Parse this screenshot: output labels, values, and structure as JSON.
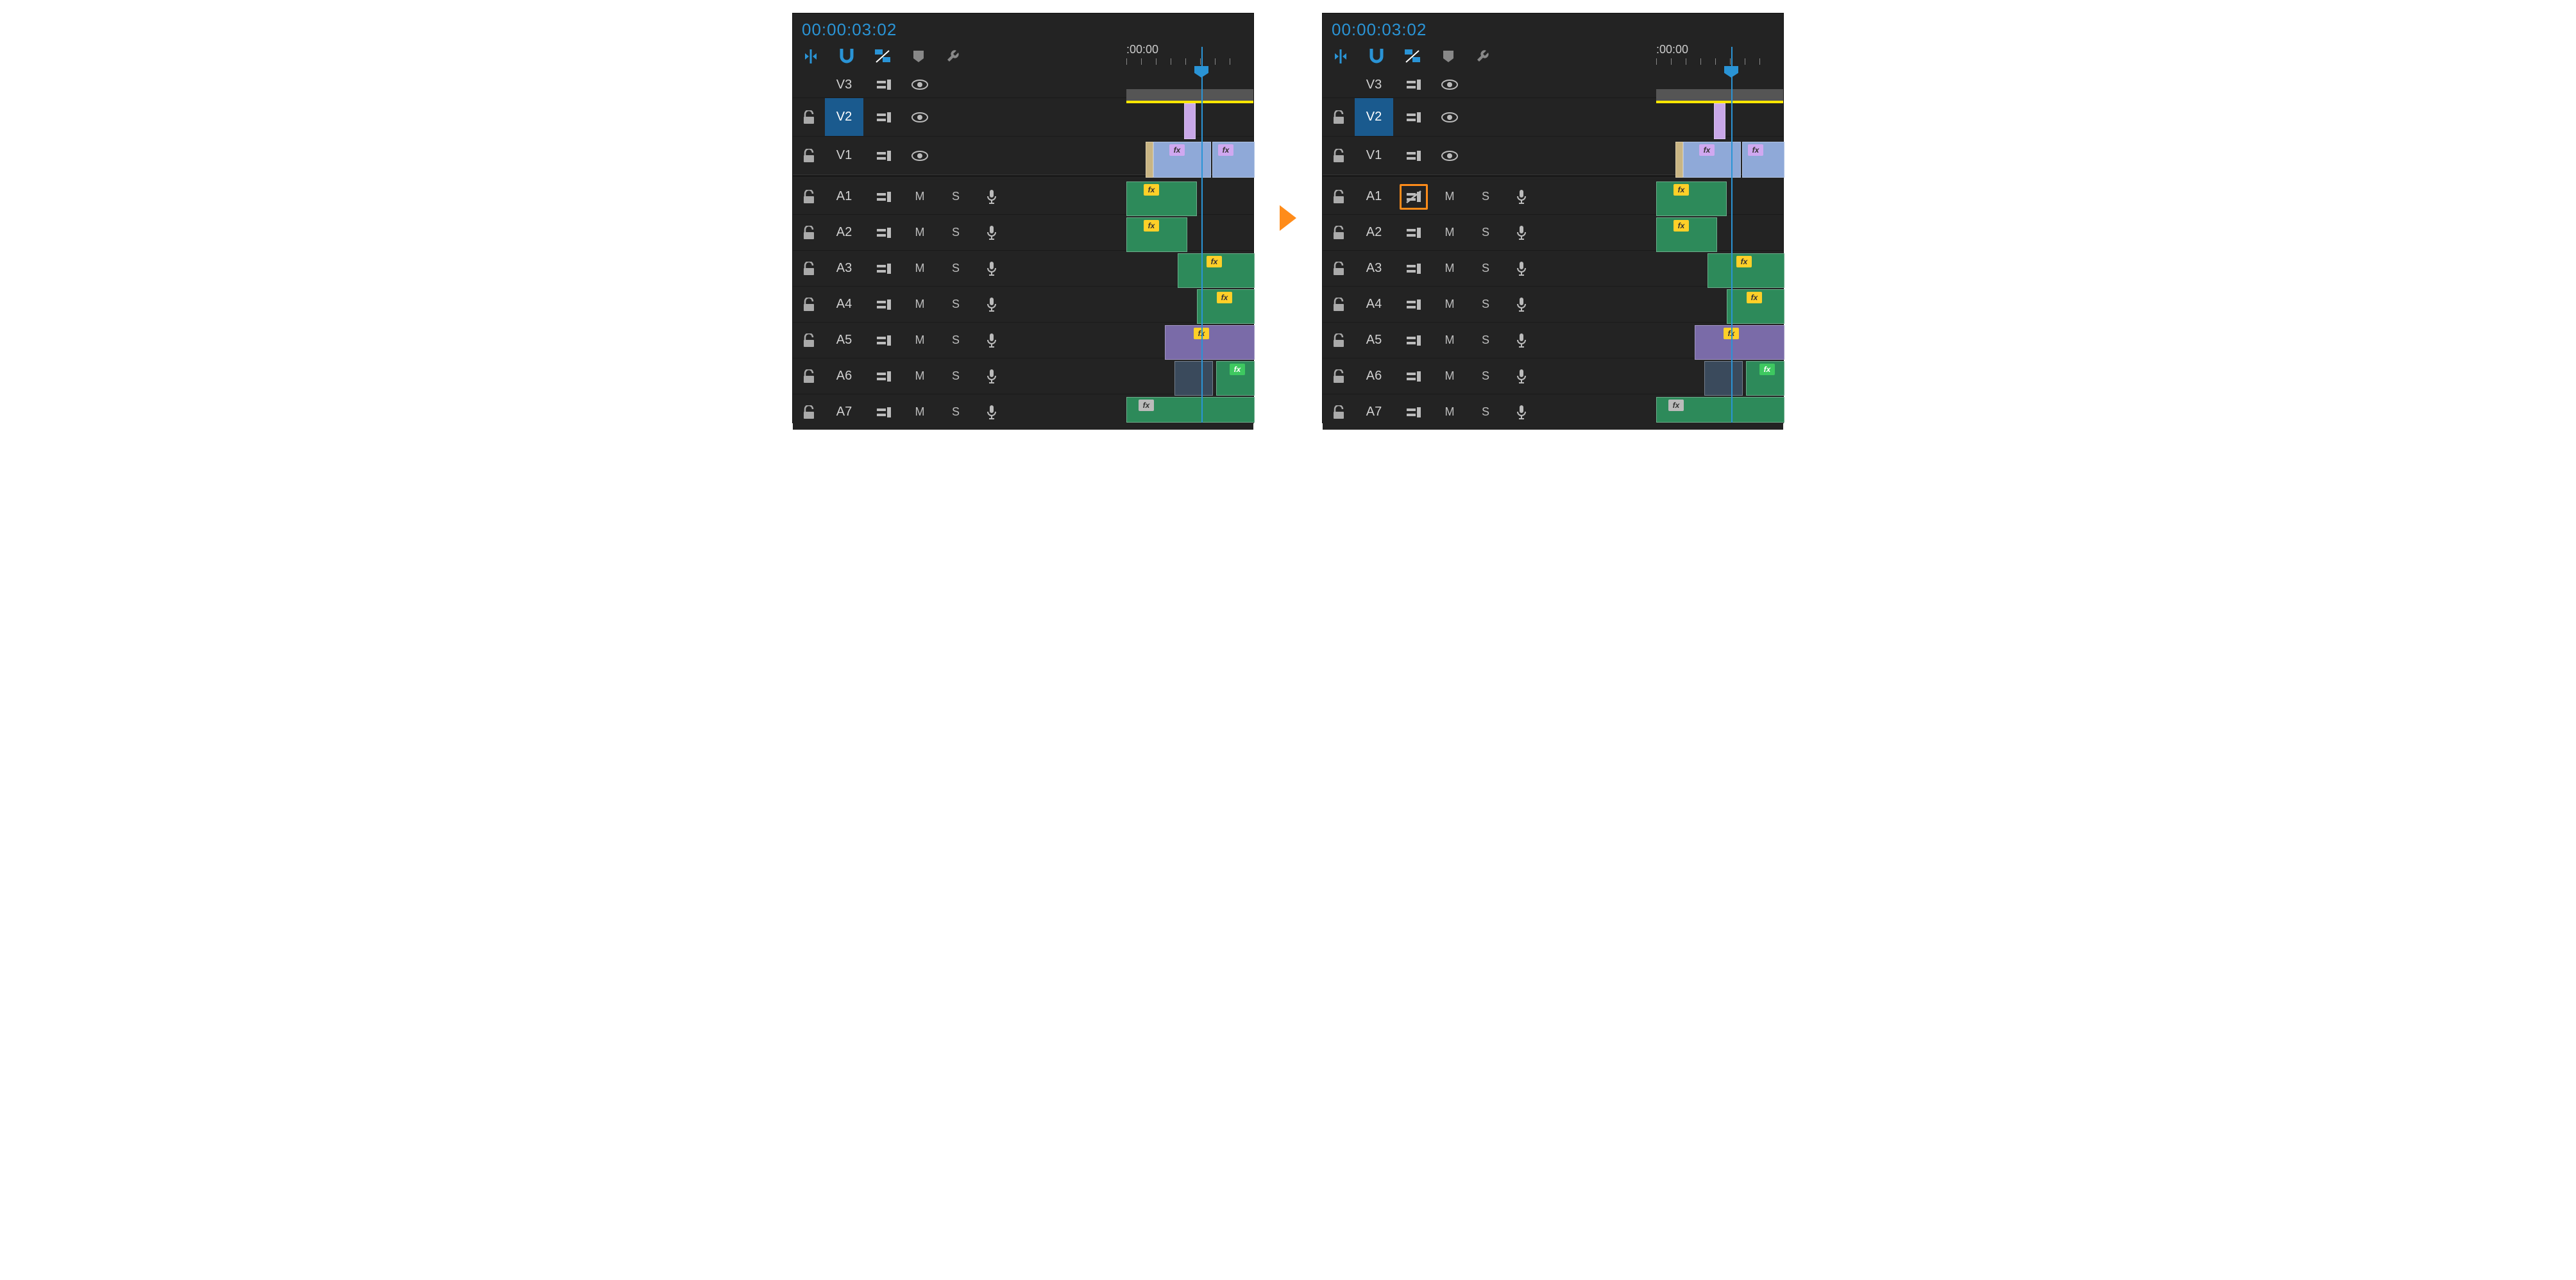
{
  "timecode": "00:00:03:02",
  "ruler_label": ":00:00",
  "toolbar": {
    "insert_overwrite": "insert-overwrite",
    "snap": "snap",
    "linked_selection": "linked-selection",
    "markers": "markers",
    "settings": "settings"
  },
  "video_tracks": [
    {
      "id": "V3",
      "label": "V3",
      "selected": false
    },
    {
      "id": "V2",
      "label": "V2",
      "selected": true
    },
    {
      "id": "V1",
      "label": "V1",
      "selected": false
    }
  ],
  "audio_tracks": [
    {
      "id": "A1",
      "label": "A1",
      "mute": "M",
      "solo": "S"
    },
    {
      "id": "A2",
      "label": "A2",
      "mute": "M",
      "solo": "S"
    },
    {
      "id": "A3",
      "label": "A3",
      "mute": "M",
      "solo": "S"
    },
    {
      "id": "A4",
      "label": "A4",
      "mute": "M",
      "solo": "S"
    },
    {
      "id": "A5",
      "label": "A5",
      "mute": "M",
      "solo": "S"
    },
    {
      "id": "A6",
      "label": "A6",
      "mute": "M",
      "solo": "S"
    },
    {
      "id": "A7",
      "label": "A7",
      "mute": "M",
      "solo": "S"
    }
  ],
  "fx_label": "fx",
  "panels": [
    {
      "sync_lock_a1_disabled": false
    },
    {
      "sync_lock_a1_disabled": true
    }
  ]
}
